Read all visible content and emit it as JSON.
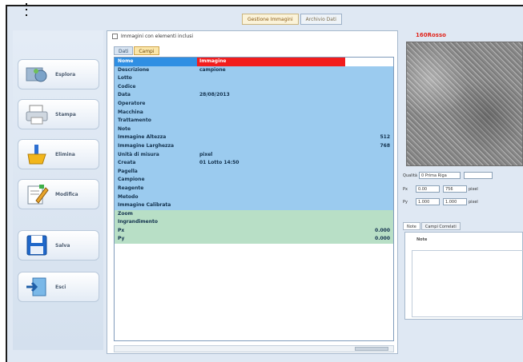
{
  "window": {
    "top_tabs": [
      "Gestione Immagini",
      "Archivio Dati"
    ]
  },
  "sidebar": {
    "items": [
      {
        "label": "Esplora",
        "icon": "explore-icon"
      },
      {
        "label": "Stampa",
        "icon": "print-icon"
      },
      {
        "label": "Elimina",
        "icon": "delete-icon"
      },
      {
        "label": "Modifica",
        "icon": "edit-icon"
      },
      {
        "label": "Salva",
        "icon": "save-icon"
      },
      {
        "label": "Esci",
        "icon": "exit-icon"
      }
    ]
  },
  "center": {
    "checkbox_label": "Immagini con elementi inclusi",
    "tabs": [
      "Dati",
      "Campi"
    ],
    "active_tab": 1,
    "rows": [
      {
        "k": "Nome",
        "v": "Immagine",
        "n": "",
        "style": "head"
      },
      {
        "k": "Descrizione",
        "v": "campione",
        "n": "",
        "style": "blue"
      },
      {
        "k": "Lotto",
        "v": "",
        "n": "",
        "style": "blue"
      },
      {
        "k": "Codice",
        "v": "",
        "n": "",
        "style": "blue"
      },
      {
        "k": "Data",
        "v": "28/08/2013",
        "n": "",
        "style": "blue"
      },
      {
        "k": "Operatore",
        "v": "",
        "n": "",
        "style": "blue"
      },
      {
        "k": "Macchina",
        "v": "",
        "n": "",
        "style": "blue"
      },
      {
        "k": "Trattamento",
        "v": "",
        "n": "",
        "style": "blue"
      },
      {
        "k": "Note",
        "v": "",
        "n": "",
        "style": "blue"
      },
      {
        "k": "Immagine Altezza",
        "v": "",
        "n": "512",
        "style": "blue"
      },
      {
        "k": "Immagine Larghezza",
        "v": "",
        "n": "768",
        "style": "blue"
      },
      {
        "k": "Unità di misura",
        "v": "pixel",
        "n": "",
        "style": "blue"
      },
      {
        "k": "Creata",
        "v": "01 Lotto 14:50",
        "n": "",
        "style": "blue"
      },
      {
        "k": "Pagella",
        "v": "",
        "n": "",
        "style": "blue"
      },
      {
        "k": "Campione",
        "v": "",
        "n": "",
        "style": "blue"
      },
      {
        "k": "Reagente",
        "v": "",
        "n": "",
        "style": "blue"
      },
      {
        "k": "Metodo",
        "v": "",
        "n": "",
        "style": "blue"
      },
      {
        "k": "Immagine Calibrata",
        "v": "",
        "n": "",
        "style": "blue"
      },
      {
        "k": "Zoom",
        "v": "",
        "n": "",
        "style": "green"
      },
      {
        "k": "Ingrandimento",
        "v": "",
        "n": "",
        "style": "green"
      },
      {
        "k": "Px",
        "v": "",
        "n": "0.000",
        "style": "green"
      },
      {
        "k": "Py",
        "v": "",
        "n": "0.000",
        "style": "green"
      }
    ]
  },
  "right": {
    "title": "160Rosso",
    "control_rows": [
      {
        "label": "Qualità",
        "a": "0 Prima Riga",
        "b": "",
        "unit": ""
      },
      {
        "label": "Px",
        "a": "0.00",
        "b": "756",
        "unit": "pixel"
      },
      {
        "label": "Py",
        "a": "1.000",
        "b": "1.000",
        "unit": "pixel"
      }
    ],
    "sub_tabs": [
      "Note",
      "Campi Correlati"
    ],
    "notes_label": "Note"
  }
}
